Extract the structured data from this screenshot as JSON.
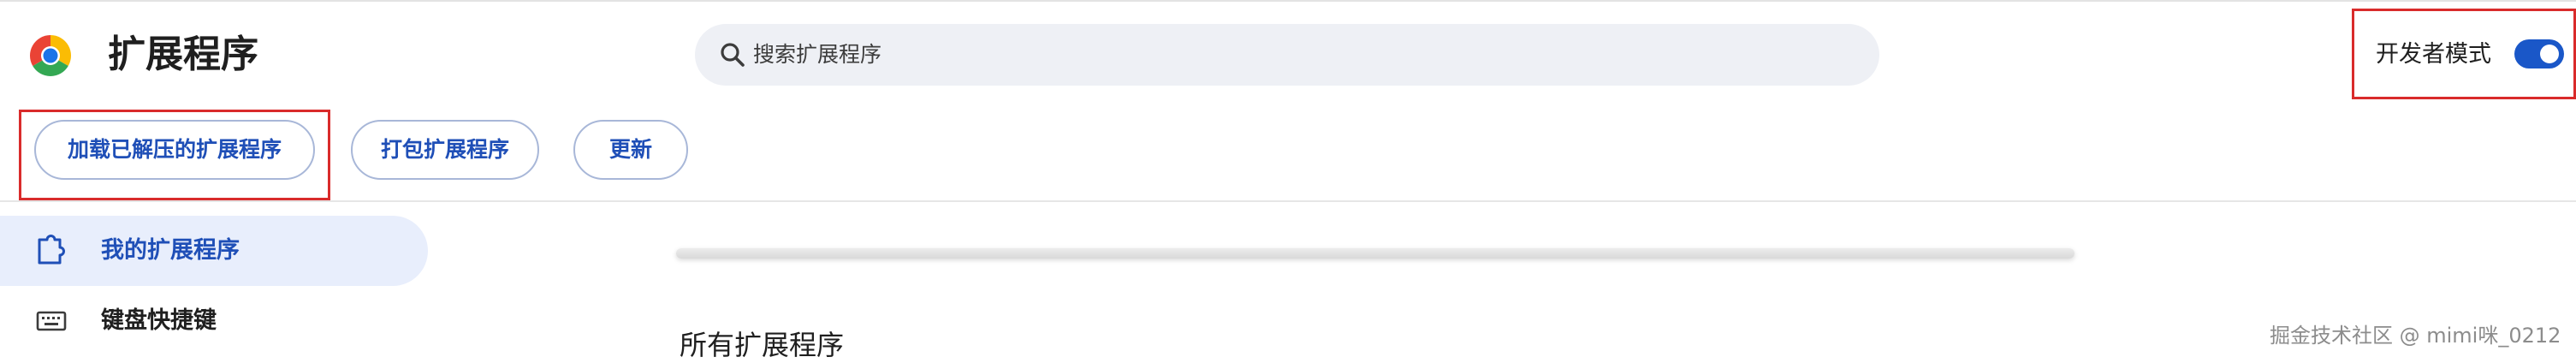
{
  "header": {
    "title": "扩展程序",
    "logo": "chrome-logo",
    "search": {
      "placeholder": "搜索扩展程序",
      "value": "",
      "icon": "search-icon"
    },
    "developer_mode": {
      "label": "开发者模式",
      "enabled": true,
      "highlighted": true
    }
  },
  "toolbar": {
    "load_unpacked_label": "加载已解压的扩展程序",
    "pack_label": "打包扩展程序",
    "update_label": "更新",
    "load_unpacked_highlighted": true
  },
  "sidebar": {
    "items": [
      {
        "label": "我的扩展程序",
        "icon": "puzzle-icon",
        "active": true
      },
      {
        "label": "键盘快捷键",
        "icon": "keyboard-icon",
        "active": false
      }
    ]
  },
  "main": {
    "section_title": "所有扩展程序"
  },
  "watermark": "掘金技术社区 @ mimi咪_0212",
  "colors": {
    "accent": "#1a57c8",
    "button_text": "#1f4fb7",
    "highlight_border": "#d92b2b",
    "active_nav_bg": "#e8eefc",
    "search_bg": "#eef0f5"
  }
}
